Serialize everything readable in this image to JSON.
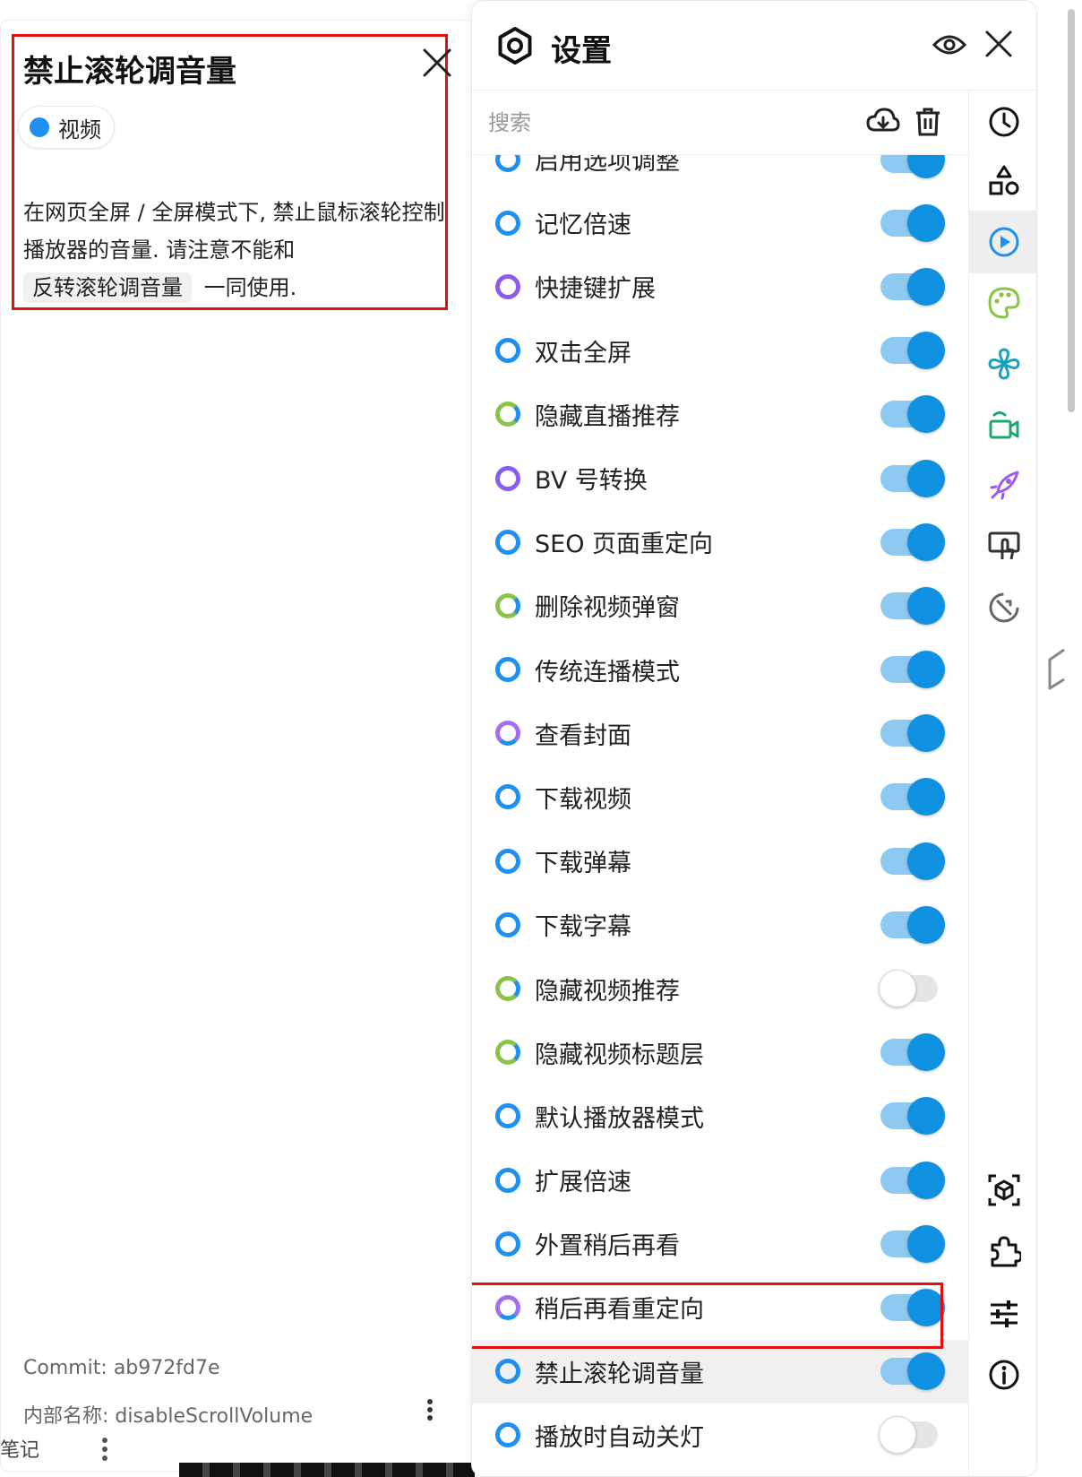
{
  "detail": {
    "title": "禁止滚轮调音量",
    "tag": "视频",
    "desc_line1": "在网页全屏 / 全屏模式下, 禁止鼠标滚轮控制",
    "desc_line2": "播放器的音量. 请注意不能和",
    "desc_chip": "反转滚轮调音量",
    "desc_tail": "一同使用.",
    "commit": "Commit: ab972fd7e",
    "internal_name": "内部名称: disableScrollVolume"
  },
  "background": {
    "note": "笔记"
  },
  "settings": {
    "title": "设置",
    "search_placeholder": "搜索",
    "items": [
      {
        "label": "启用选项调整",
        "ring": "blue",
        "on": true
      },
      {
        "label": "记忆倍速",
        "ring": "blue",
        "on": true
      },
      {
        "label": "快捷键扩展",
        "ring": "purple",
        "on": true
      },
      {
        "label": "双击全屏",
        "ring": "blue",
        "on": true
      },
      {
        "label": "隐藏直播推荐",
        "ring": "green",
        "on": true
      },
      {
        "label": "BV 号转换",
        "ring": "purple",
        "on": true
      },
      {
        "label": "SEO 页面重定向",
        "ring": "blue",
        "on": true
      },
      {
        "label": "删除视频弹窗",
        "ring": "green",
        "on": true
      },
      {
        "label": "传统连播模式",
        "ring": "blue",
        "on": true
      },
      {
        "label": "查看封面",
        "ring": "violet",
        "on": true
      },
      {
        "label": "下载视频",
        "ring": "blue",
        "on": true
      },
      {
        "label": "下载弹幕",
        "ring": "blue",
        "on": true
      },
      {
        "label": "下载字幕",
        "ring": "blue",
        "on": true
      },
      {
        "label": "隐藏视频推荐",
        "ring": "green",
        "on": false
      },
      {
        "label": "隐藏视频标题层",
        "ring": "green",
        "on": true
      },
      {
        "label": "默认播放器模式",
        "ring": "blue",
        "on": true
      },
      {
        "label": "扩展倍速",
        "ring": "blue",
        "on": true
      },
      {
        "label": "外置稍后再看",
        "ring": "blue",
        "on": true
      },
      {
        "label": "稍后再看重定向",
        "ring": "violet",
        "on": true
      },
      {
        "label": "禁止滚轮调音量",
        "ring": "blue",
        "on": true,
        "selected": true
      },
      {
        "label": "播放时自动关灯",
        "ring": "blue",
        "on": false
      }
    ]
  },
  "rail": {
    "top": [
      "clock-icon",
      "shapes-icon",
      "play-circle-icon",
      "palette-icon",
      "pinwheel-icon",
      "live-camera-icon",
      "rocket-icon",
      "touch-screen-icon",
      "tools-icon"
    ],
    "bottom": [
      "cube-scan-icon",
      "puzzle-icon",
      "sliders-icon",
      "info-icon"
    ],
    "active": "play-circle-icon"
  },
  "colors": {
    "accent": "#1e90f0",
    "highlight": "#e30f0f",
    "toggle_track": "#8ec9f2"
  }
}
